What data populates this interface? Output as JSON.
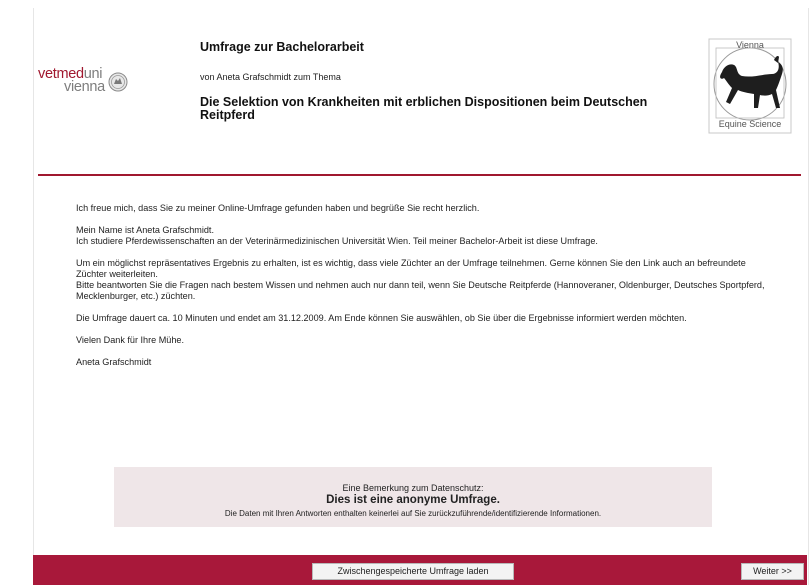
{
  "header": {
    "logo_left_part1": "vetmed",
    "logo_left_part2": "uni",
    "logo_left_line2": "vienna",
    "title": "Umfrage zur Bachelorarbeit",
    "subtitle": "von Aneta Grafschmidt zum Thema",
    "topic": "Die Selektion von Krankheiten mit erblichen Dispositionen beim Deutschen Reitpferd",
    "logo_right_top": "Vienna",
    "logo_right_bottom": "Equine Science"
  },
  "content": {
    "greeting": "Ich freue mich, dass Sie zu meiner Online-Umfrage gefunden haben und begrüße Sie recht herzlich.",
    "intro_line1": "Mein Name ist Aneta Grafschmidt.",
    "intro_line2": "Ich studiere Pferdewissenschaften an der Veterinärmedizinischen Universität Wien. Teil meiner Bachelor-Arbeit ist diese Umfrage.",
    "purpose_line1": "Um ein möglichst repräsentatives Ergebnis zu erhalten, ist es wichtig, dass viele Züchter an der Umfrage teilnehmen. Gerne können Sie den Link auch an befreundete Züchter weiterleiten.",
    "purpose_line2": "Bitte beantworten Sie die Fragen nach bestem Wissen und nehmen auch nur dann teil, wenn Sie Deutsche Reitpferde (Hannoveraner, Oldenburger, Deutsches Sportpferd, Mecklenburger, etc.) züchten.",
    "duration": "Die Umfrage dauert ca. 10 Minuten und endet am 31.12.2009. Am Ende können Sie auswählen, ob Sie über die Ergebnisse informiert werden möchten.",
    "thanks": "Vielen Dank für Ihre Mühe.",
    "signature": "Aneta Grafschmidt"
  },
  "notice": {
    "label": "Eine Bemerkung zum Datenschutz:",
    "headline": "Dies ist eine anonyme Umfrage.",
    "detail": "Die Daten mit Ihren Antworten enthalten keinerlei auf Sie zurückzuführende/identifizierende Informationen."
  },
  "footer": {
    "load_button": "Zwischengespeicherte Umfrage laden",
    "next_button": "Weiter >>"
  },
  "colors": {
    "brand": "#a0182f",
    "footer_bar": "#a8183a",
    "notice_bg": "#efe6e8"
  },
  "icons": {
    "university_seal": "university-seal-icon",
    "horse_logo": "horse-icon"
  }
}
